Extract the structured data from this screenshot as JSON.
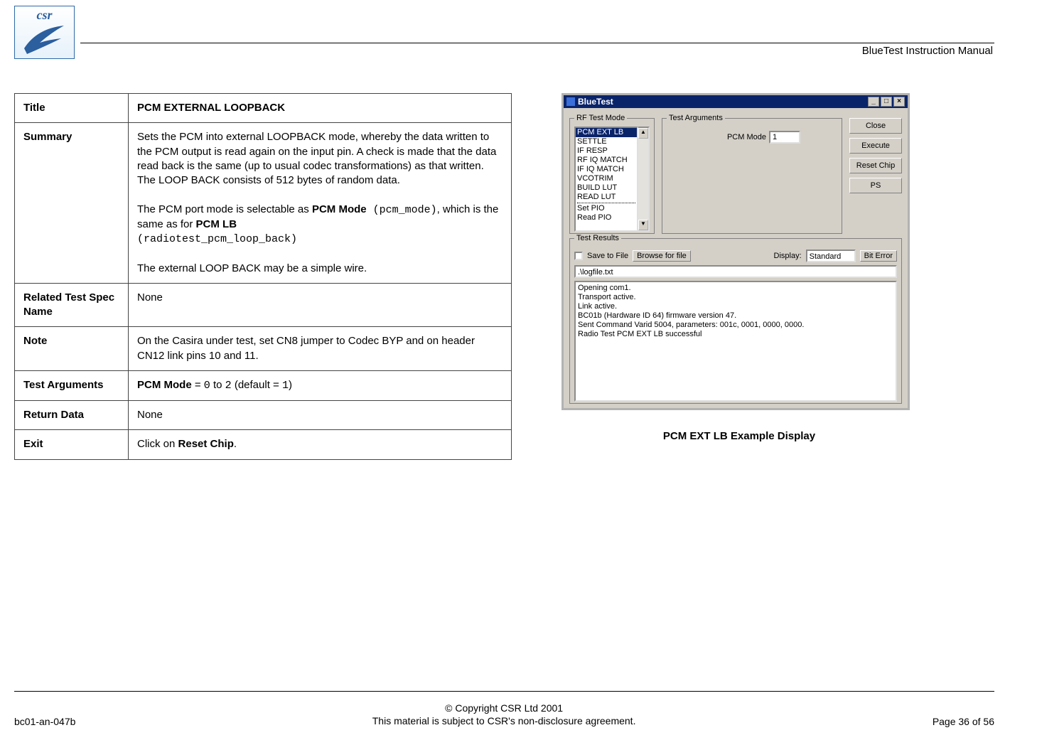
{
  "header": {
    "logo_text": "csr",
    "doc_title": "BlueTest Instruction Manual"
  },
  "spec": {
    "rows": {
      "title_label": "Title",
      "title_value": "PCM EXTERNAL LOOPBACK",
      "summary_label": "Summary",
      "summary_p1": "Sets the PCM into external LOOPBACK mode, whereby the data written to the PCM output is read again on the input pin. A check is made that the data read back is the same (up to usual codec transformations) as that written. The LOOP BACK consists of 512 bytes of random data.",
      "summary_p2_a": "The PCM port mode is selectable as ",
      "summary_p2_b": "PCM Mode",
      "summary_p2_c": " (pcm_mode)",
      "summary_p2_d": ", which is the same as for ",
      "summary_p2_e": "PCM LB",
      "summary_p2_f": " (radiotest_pcm_loop_back)",
      "summary_p3": "The external LOOP BACK may be a simple wire.",
      "related_label": "Related Test Spec Name",
      "related_value": "None",
      "note_label": "Note",
      "note_value": "On the Casira under test, set CN8 jumper to Codec BYP and on header CN12 link pins 10 and 11.",
      "testargs_label": "Test Arguments",
      "testargs_a": "PCM Mode",
      "testargs_b": " = ",
      "testargs_c": "0",
      "testargs_d": " to ",
      "testargs_e": "2",
      "testargs_f": "  (default = ",
      "testargs_g": "1",
      "testargs_h": ")",
      "return_label": "Return Data",
      "return_value": "None",
      "exit_label": "Exit",
      "exit_a": "Click on ",
      "exit_b": "Reset Chip",
      "exit_c": "."
    }
  },
  "app": {
    "title": "BlueTest",
    "groups": {
      "rf": "RF Test Mode",
      "args": "Test Arguments",
      "results": "Test Results"
    },
    "rf_items": [
      "PCM EXT LB",
      "SETTLE",
      "IF RESP",
      "RF IQ MATCH",
      "IF IQ MATCH",
      "VCOTRIM",
      "BUILD LUT",
      "READ LUT",
      "-----------",
      "Set PIO",
      "Read PIO"
    ],
    "rf_selected_index": 0,
    "arg_label": "PCM Mode",
    "arg_value": "1",
    "buttons": {
      "close": "Close",
      "execute": "Execute",
      "reset": "Reset Chip",
      "ps": "PS"
    },
    "results": {
      "save_label": "Save to File",
      "browse": "Browse for file",
      "display_label": "Display:",
      "display_value": "Standard",
      "biterror": "Bit Error",
      "file_path": ".\\logfile.txt",
      "log": [
        "Opening com1.",
        "Transport active.",
        "Link active.",
        "BC01b (Hardware ID 64) firmware version 47.",
        "Sent Command Varid 5004, parameters: 001c, 0001, 0000, 0000.",
        "Radio Test PCM EXT LB successful"
      ]
    },
    "caption": "PCM EXT LB Example Display"
  },
  "footer": {
    "left": "bc01-an-047b",
    "c1": "© Copyright CSR Ltd 2001",
    "c2": "This material is subject to CSR's non-disclosure agreement.",
    "right": "Page 36 of 56"
  }
}
